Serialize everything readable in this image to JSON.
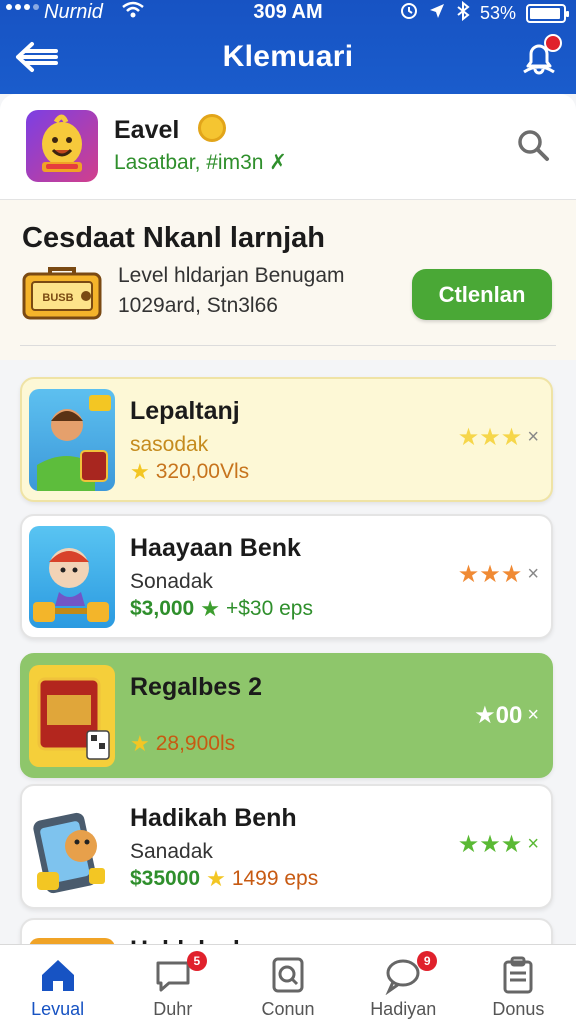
{
  "status_bar": {
    "carrier": "Nurnid",
    "time": "309 AM",
    "battery": "53%"
  },
  "header": {
    "title": "Klemuari"
  },
  "profile": {
    "name": "Eavel",
    "subtitle": "Lasatbar, #im3n",
    "check": "✗"
  },
  "challenge": {
    "heading": "Cesdaat Nkanl larnjah",
    "badge_text": "BUSB",
    "line1": "Level hldarjan Benugam",
    "line2": "1029ard, Stn3l66",
    "button_label": "Ctlenlan"
  },
  "list": [
    {
      "title": "Lepaltanj",
      "subtitle": "sasodak",
      "meta_a": "",
      "meta_b": "320,00Vls",
      "star_color": "#f3c623",
      "rating": "★★★",
      "style": "yellow"
    },
    {
      "title": "Haayaan Benk",
      "subtitle": "Sonadak",
      "meta_a": "$3,000",
      "meta_b": "+$30 eps",
      "star_color": "#f08a34",
      "rating": "★★★",
      "style": "white"
    },
    {
      "title": "Regalbes 2",
      "subtitle": "",
      "meta_a": "",
      "meta_b": "28,900ls",
      "star_color": "#ffffff",
      "rating": "★00",
      "style": "green"
    },
    {
      "title": "Hadikah Benh",
      "subtitle": "Sanadak",
      "meta_a": "$35000",
      "meta_b": "1499 eps",
      "star_color": "#5ab934",
      "rating": "★★★",
      "style": "white"
    },
    {
      "title": "Hablaleal",
      "subtitle": "",
      "meta_a": "",
      "meta_b": "",
      "star_color": "#cccccc",
      "rating": "",
      "style": "white"
    }
  ],
  "tabs": [
    {
      "label": "Levual",
      "badge": ""
    },
    {
      "label": "Duhr",
      "badge": "5"
    },
    {
      "label": "Conun",
      "badge": ""
    },
    {
      "label": "Hadiyan",
      "badge": "9"
    },
    {
      "label": "Donus",
      "badge": ""
    }
  ],
  "colors": {
    "primary": "#1753c3",
    "accent_green": "#4aa836",
    "badge_red": "#e0212c"
  }
}
